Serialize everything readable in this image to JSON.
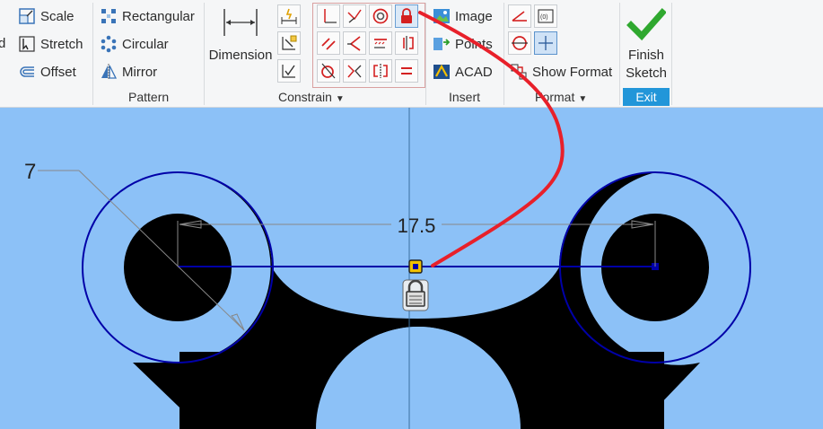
{
  "ribbon": {
    "edit_group": {
      "clip_label": "d",
      "scale": "Scale",
      "stretch": "Stretch",
      "offset": "Offset"
    },
    "pattern_group": {
      "rectangular": "Rectangular",
      "circular": "Circular",
      "mirror": "Mirror",
      "label": "Pattern"
    },
    "constrain_group": {
      "dimension": "Dimension",
      "label": "Constrain"
    },
    "insert_group": {
      "image": "Image",
      "points": "Points",
      "acad": "ACAD",
      "label": "Insert"
    },
    "format_group": {
      "show_format": "Show Format",
      "label": "Format"
    },
    "exit_group": {
      "finish_line1": "Finish",
      "finish_line2": "Sketch",
      "label": "Exit"
    }
  },
  "sketch": {
    "radius_dimension": "7",
    "linear_dimension": "17.5"
  },
  "colors": {
    "canvas_bg": "#8cc1f7",
    "part_fill": "#000000",
    "sketch_line": "#0000a8",
    "annotation_red": "#e8202a",
    "constraint_yellow": "#f0c000",
    "finish_green": "#2fa82f",
    "exit_blue": "#2296d9"
  }
}
